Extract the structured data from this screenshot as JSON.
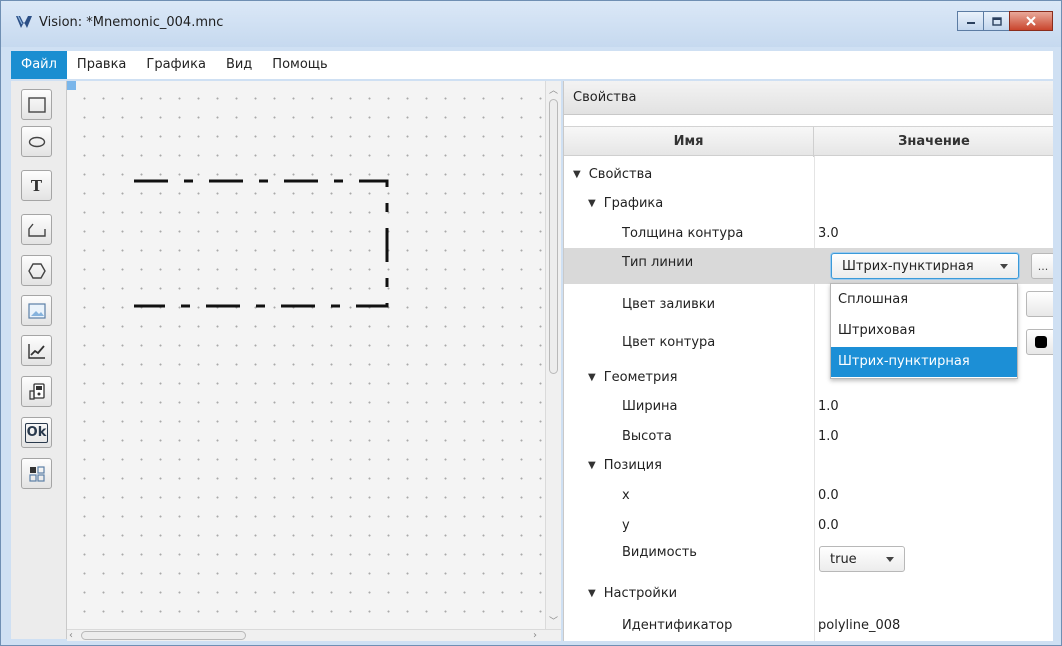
{
  "window": {
    "title": "Vision: *Mnemonic_004.mnc",
    "colors": {
      "accent": "#1a8ed1",
      "titlebar": "#cfe0f3",
      "close": "#c9452d"
    }
  },
  "menu": {
    "items": [
      {
        "label": "Файл",
        "active": true
      },
      {
        "label": "Правка"
      },
      {
        "label": "Графика"
      },
      {
        "label": "Вид"
      },
      {
        "label": "Помощь"
      }
    ]
  },
  "toolbox": {
    "tools": [
      "rectangle-tool",
      "ellipse-tool",
      "text-tool",
      "polyline-tool",
      "polygon-tool",
      "image-tool",
      "chart-tool",
      "device-tool",
      "button-tool",
      "widget-tool"
    ],
    "text_tool_glyph": "T",
    "ok_tool_label": "Ok"
  },
  "properties": {
    "panel_title": "Свойства",
    "columns": {
      "name": "Имя",
      "value": "Значение"
    },
    "root": "Свойства",
    "groups": {
      "graphics": "Графика",
      "geometry": "Геометрия",
      "position": "Позиция",
      "settings": "Настройки"
    },
    "rows": {
      "stroke_width": {
        "label": "Толщина контура",
        "value": "3.0"
      },
      "line_type": {
        "label": "Тип линии",
        "value": "Штрих-пунктирная",
        "more_button": "..."
      },
      "fill_color": {
        "label": "Цвет заливки"
      },
      "stroke_color": {
        "label": "Цвет контура",
        "color": "#000000"
      },
      "width": {
        "label": "Ширина",
        "value": "1.0"
      },
      "height": {
        "label": "Высота",
        "value": "1.0"
      },
      "x": {
        "label": "x",
        "value": "0.0"
      },
      "y": {
        "label": "y",
        "value": "0.0"
      },
      "visibility": {
        "label": "Видимость",
        "value": "true"
      },
      "identifier": {
        "label": "Идентификатор",
        "value": "polyline_008"
      }
    },
    "line_type_options": [
      "Сплошная",
      "Штриховая",
      "Штрих-пунктирная"
    ],
    "selected_option_index": 2
  }
}
